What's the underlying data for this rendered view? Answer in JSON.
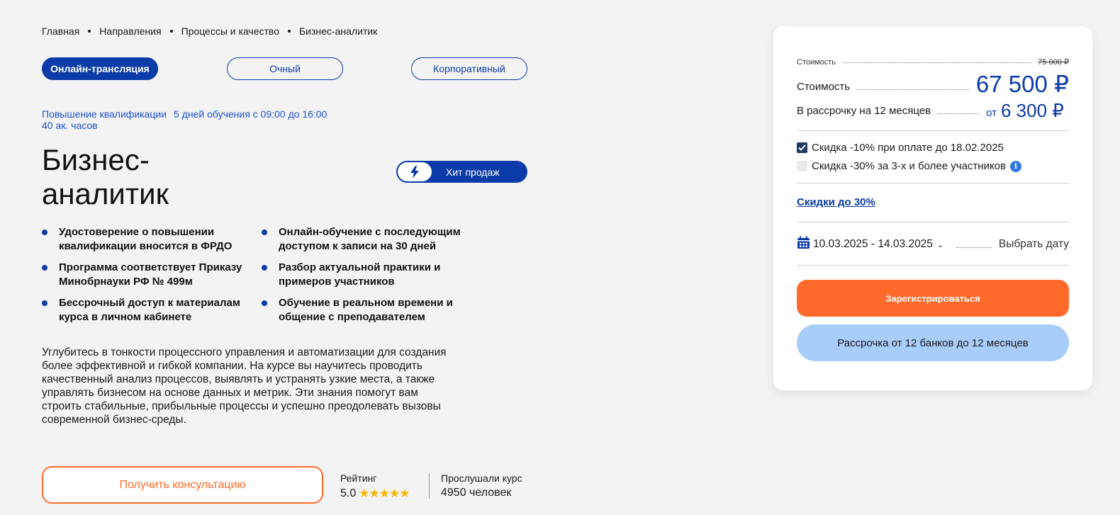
{
  "breadcrumb": [
    "Главная",
    "Направления",
    "Процессы и качество",
    "Бизнес-аналитик"
  ],
  "format_tabs": {
    "online": "Онлайн-трансляция",
    "inperson": "Очный",
    "corporate": "Корпоративный",
    "active": "online"
  },
  "meta": {
    "type": "Повышение квалификации",
    "schedule": "5 дней обучения с 09:00 до 16:00",
    "hours": "40 ак. часов"
  },
  "course": {
    "title_line1": "Бизнес-",
    "title_line2": "аналитик",
    "badge": "Хит продаж"
  },
  "features": [
    "Удостоверение о повышении квалификации вносится в ФРДО",
    "Онлайн-обучение с последующим доступом к записи на 30 дней",
    "Программа соответствует Приказу Минобрнауки РФ № 499м",
    "Разбор актуальной практики и примеров участников",
    "Бессрочный доступ к материалам курса в личном кабинете",
    "Обучение в реальном времени и общение с преподавателем"
  ],
  "description": "Углубитесь в тонкости процессного управления и автоматизации для создания более эффективной и гибкой компании. На курсе вы научитесь проводить качественный анализ процессов, выявлять и устранять узкие места, а также управлять бизнесом на основе данных и метрик. Эти знания помогут вам строить стабильные, прибыльные процессы и успешно преодолевать вызовы современной бизнес-среды.",
  "consult_button": "Получить консультацию",
  "rating": {
    "label": "Рейтинг",
    "value": "5.0",
    "stars": "★★★★★"
  },
  "listened": {
    "label": "Прослушали курс",
    "value": "4950 человек"
  },
  "pricing": {
    "old_label": "Стоимость",
    "old_price": "75 000 ₽",
    "label": "Стоимость",
    "price": "67 500 ₽",
    "installment_label": "В рассрочку на 12 месяцев",
    "installment_from": "от",
    "installment_price": "6 300 ₽"
  },
  "discounts": {
    "early": {
      "label": "Скидка -10% при оплате до 18.02.2025",
      "checked": true
    },
    "group": {
      "label": "Скидка -30% за 3-х и более участников",
      "checked": false
    },
    "link": "Скидки до 30%"
  },
  "dates": {
    "range": "10.03.2025 - 14.03.2025",
    "pick": "Выбрать дату"
  },
  "register_button": "Зарегистрироваться",
  "installment_button": "Рассрочка от 12 банков до 12 месяцев",
  "colors": {
    "brand": "#0a3ba8",
    "accent": "#ff6a2a",
    "light_blue": "#a9cdfa"
  }
}
